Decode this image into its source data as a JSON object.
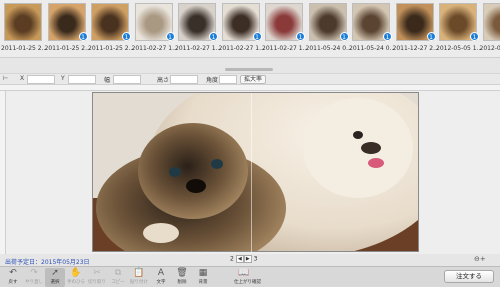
{
  "filmstrip": {
    "items": [
      {
        "caption": "2011-01-25 2...",
        "badge": ""
      },
      {
        "caption": "2011-01-25 2...",
        "badge": "1"
      },
      {
        "caption": "2011-01-25 2...",
        "badge": "1"
      },
      {
        "caption": "2011-02-27 1...",
        "badge": "1"
      },
      {
        "caption": "2011-02-27 1...",
        "badge": "1"
      },
      {
        "caption": "2011-02-27 1...",
        "badge": "1"
      },
      {
        "caption": "2011-02-27 1...",
        "badge": "1"
      },
      {
        "caption": "2011-05-24 0...",
        "badge": "1"
      },
      {
        "caption": "2011-05-24 0...",
        "badge": "1"
      },
      {
        "caption": "2011-12-27 2...",
        "badge": "1"
      },
      {
        "caption": "2012-05-05 1...",
        "badge": "1"
      },
      {
        "caption": "2012-05-05 1...",
        "badge": ""
      }
    ]
  },
  "propbar": {
    "x_label": "X",
    "y_label": "Y",
    "w_label": "幅",
    "h_label": "高さ",
    "angle_label": "角度",
    "zoom_button": "拡大率"
  },
  "status": {
    "publish_date": "出荷予定日：2015年05月23日",
    "page_current": "2",
    "page_next": "3"
  },
  "toolbar": {
    "tools": [
      {
        "icon": "undo-icon",
        "glyph": "↶",
        "label": "戻す",
        "dim": false
      },
      {
        "icon": "redo-icon",
        "glyph": "↷",
        "label": "やり直し",
        "dim": true
      },
      {
        "icon": "select-icon",
        "glyph": "➚",
        "label": "選択",
        "dim": false,
        "active": true
      },
      {
        "icon": "hand-icon",
        "glyph": "✋",
        "label": "手のひら",
        "dim": true
      },
      {
        "icon": "cut-icon",
        "glyph": "✂",
        "label": "切り取り",
        "dim": true
      },
      {
        "icon": "copy-icon",
        "glyph": "⧉",
        "label": "コピー",
        "dim": true
      },
      {
        "icon": "paste-icon",
        "glyph": "📋",
        "label": "貼り付け",
        "dim": true
      },
      {
        "icon": "text-icon",
        "glyph": "A",
        "label": "文字",
        "dim": false
      },
      {
        "icon": "delete-icon",
        "glyph": "🗑",
        "label": "削除",
        "dim": false
      },
      {
        "icon": "layout-icon",
        "glyph": "▦",
        "label": "背景",
        "dim": false
      },
      {
        "icon": "preview-icon",
        "glyph": "📖",
        "label": "仕上がり確認",
        "dim": false
      }
    ],
    "order_button": "注文する"
  }
}
